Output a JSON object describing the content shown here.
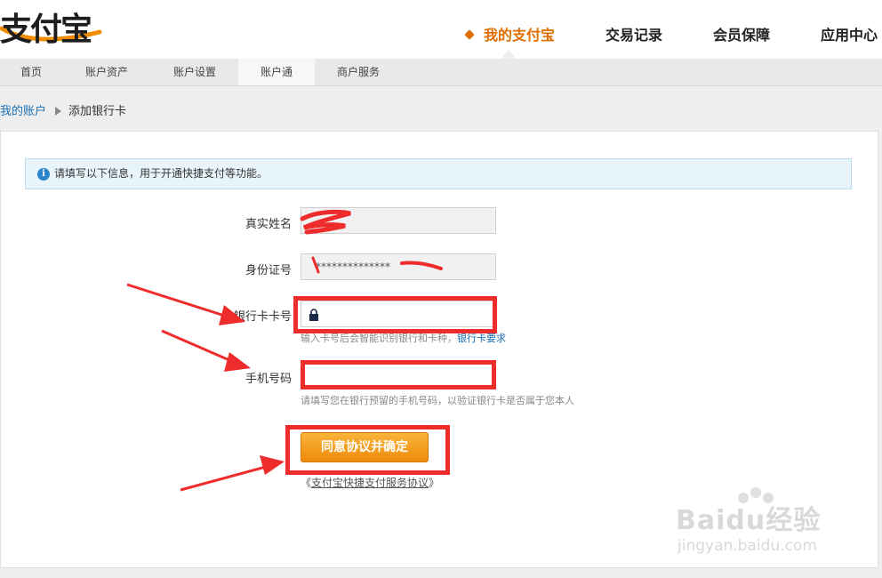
{
  "header": {
    "logo_text": "支付宝",
    "nav": [
      {
        "label": "我的支付宝",
        "active": true
      },
      {
        "label": "交易记录",
        "active": false
      },
      {
        "label": "会员保障",
        "active": false
      },
      {
        "label": "应用中心",
        "active": false
      }
    ]
  },
  "subnav": [
    {
      "label": "首页"
    },
    {
      "label": "账户资产"
    },
    {
      "label": "账户设置"
    },
    {
      "label": "账户通",
      "active": true
    },
    {
      "label": "商户服务"
    }
  ],
  "breadcrumb": {
    "parent": "我的账户",
    "current": "添加银行卡"
  },
  "notice": "请填写以下信息，用于开通快捷支付等功能。",
  "form": {
    "name_label": "真实姓名",
    "id_label": "身份证号",
    "id_value": "**************",
    "card_label": "银行卡卡号",
    "card_hint": "输入卡号后会智能识别银行和卡种，",
    "card_hint_link": "银行卡要求",
    "phone_label": "手机号码",
    "phone_hint": "请填写您在银行预留的手机号码，以验证银行卡是否属于您本人",
    "submit_label": "同意协议并确定",
    "agreement_open": "《",
    "agreement_link": "支付宝快捷支付服务协议",
    "agreement_close": "》"
  },
  "watermark": {
    "main": "Baidu经验",
    "sub": "jingyan.baidu.com"
  },
  "colors": {
    "accent": "#e06d00",
    "link": "#1a6fb5",
    "annotation": "#ee2c2c",
    "button": "#f29a17"
  }
}
